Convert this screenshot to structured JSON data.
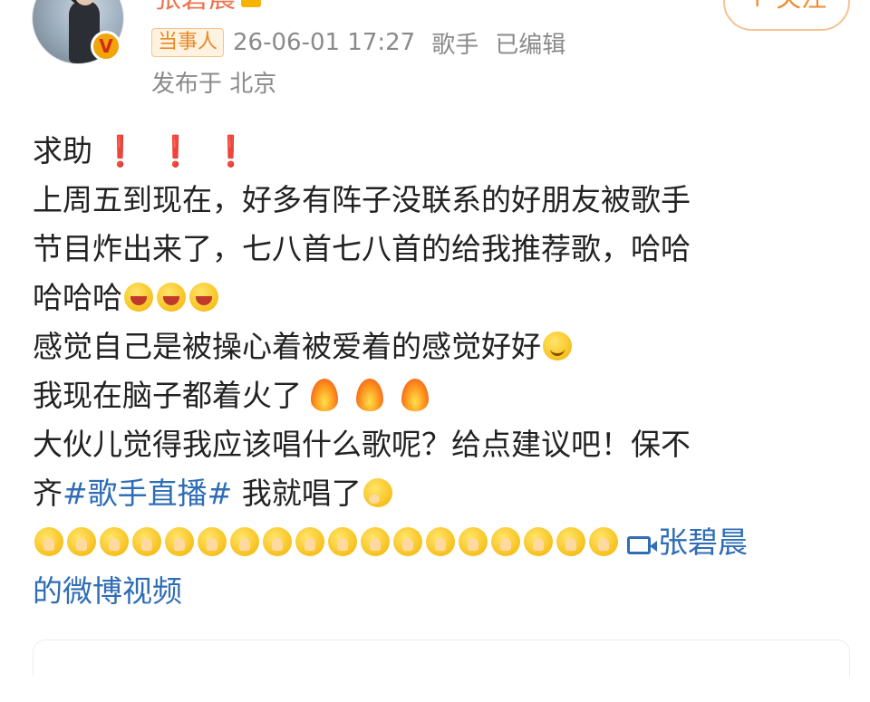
{
  "user": {
    "name": "张碧晨",
    "verified_badge": "V",
    "avatar_icon": "avatar-photo"
  },
  "follow_button": {
    "label": "+ 关注"
  },
  "meta": {
    "tag": "当事人",
    "timestamp": "26-06-01 17:27",
    "role": "歌手",
    "edited": "已编辑",
    "location": "发布于 北京"
  },
  "post": {
    "line1": "求助",
    "line1_marks": [
      "❗",
      "❗",
      "❗"
    ],
    "line2": "上周五到现在，好多有阵子没联系的好朋友被歌手",
    "line3": "节目炸出来了，七八首七八首的给我推荐歌，哈哈",
    "line4": "哈哈哈",
    "line5": "感觉自己是被操心着被爱着的感觉好好",
    "line6": "我现在脑子都着火了",
    "line7": "大伙儿觉得我应该唱什么歌呢？给点建议吧！保不",
    "line8_before": "齐",
    "line8_hashtag": "#歌手直播#",
    "line8_after": " 我就唱了",
    "video_link_part1": "张碧晨",
    "video_link_part2": "的微博视频"
  },
  "icons": {
    "laugh": "laughing-emoji",
    "happy": "happy-emoji",
    "fire": "fire-emoji",
    "think": "thinking-emoji",
    "pray": "praying-emoji",
    "video": "video-icon"
  },
  "colors": {
    "link": "#2f6db5",
    "username": "#eb7350",
    "meta": "#8a8a8a",
    "follow": "#f08a2c",
    "exclamation": "#e0271f"
  }
}
